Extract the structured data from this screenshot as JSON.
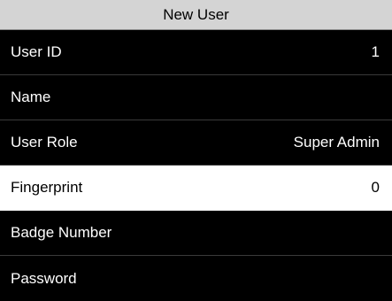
{
  "header": {
    "title": "New User"
  },
  "menu": {
    "items": [
      {
        "label": "User ID",
        "value": "1"
      },
      {
        "label": "Name",
        "value": ""
      },
      {
        "label": "User Role",
        "value": "Super Admin"
      },
      {
        "label": "Fingerprint",
        "value": "0"
      },
      {
        "label": "Badge Number",
        "value": ""
      },
      {
        "label": "Password",
        "value": ""
      }
    ],
    "selected_label": "Fingerprint"
  },
  "colors": {
    "background": "#000000",
    "title_bar": "#d4d4d4",
    "selected_row": "#ffffff",
    "text": "#ffffff"
  }
}
